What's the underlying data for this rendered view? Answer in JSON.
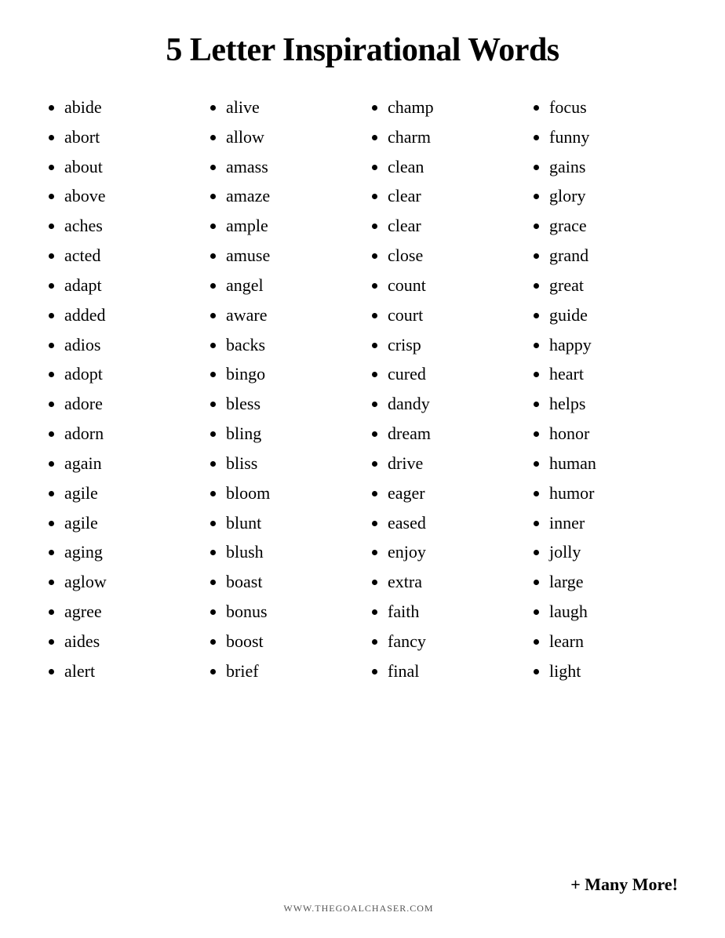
{
  "title": "5 Letter Inspirational Words",
  "columns": [
    {
      "words": [
        "abide",
        "abort",
        "about",
        "above",
        "aches",
        "acted",
        "adapt",
        "added",
        "adios",
        "adopt",
        "adore",
        "adorn",
        "again",
        "agile",
        "agile",
        "aging",
        "aglow",
        "agree",
        "aides",
        "alert"
      ]
    },
    {
      "words": [
        "alive",
        "allow",
        "amass",
        "amaze",
        "ample",
        "amuse",
        "angel",
        "aware",
        "backs",
        "bingo",
        "bless",
        "bling",
        "bliss",
        "bloom",
        "blunt",
        "blush",
        "boast",
        "bonus",
        "boost",
        "brief"
      ]
    },
    {
      "words": [
        "champ",
        "charm",
        "clean",
        "clear",
        "clear",
        "close",
        "count",
        "court",
        "crisp",
        "cured",
        "dandy",
        "dream",
        "drive",
        "eager",
        "eased",
        "enjoy",
        "extra",
        "faith",
        "fancy",
        "final"
      ]
    },
    {
      "words": [
        "focus",
        "funny",
        "gains",
        "glory",
        "grace",
        "grand",
        "great",
        "guide",
        "happy",
        "heart",
        "helps",
        "honor",
        "human",
        "humor",
        "inner",
        "jolly",
        "large",
        "laugh",
        "learn",
        "light"
      ]
    }
  ],
  "many_more": "+ Many More!",
  "website": "WWW.THEGOALCHASER.COM"
}
